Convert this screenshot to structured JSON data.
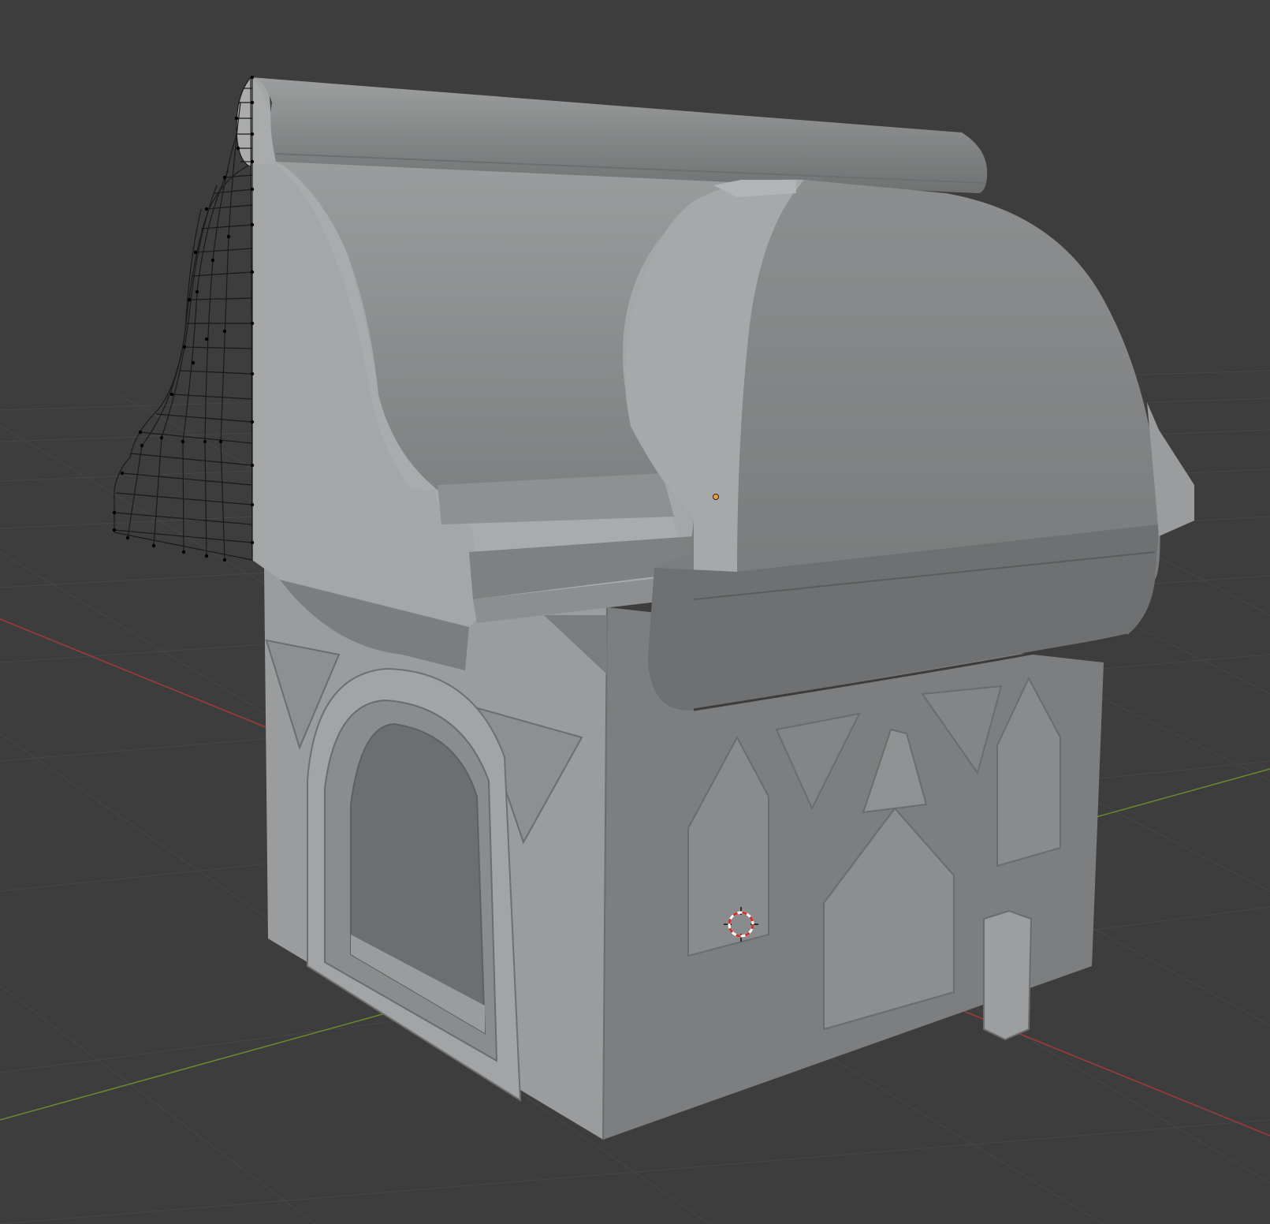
{
  "viewport": {
    "background": "#3d3d3d",
    "grid_color": "#4a4a4a",
    "x_axis_color": "#a33a3a",
    "y_axis_color": "#6a8a2e"
  },
  "model": {
    "object": "house-building-mesh",
    "edit_overlay": "wireframe-on-roof-gable"
  },
  "icons": {
    "cursor": "3d-cursor-icon",
    "origin": "object-origin-icon"
  }
}
